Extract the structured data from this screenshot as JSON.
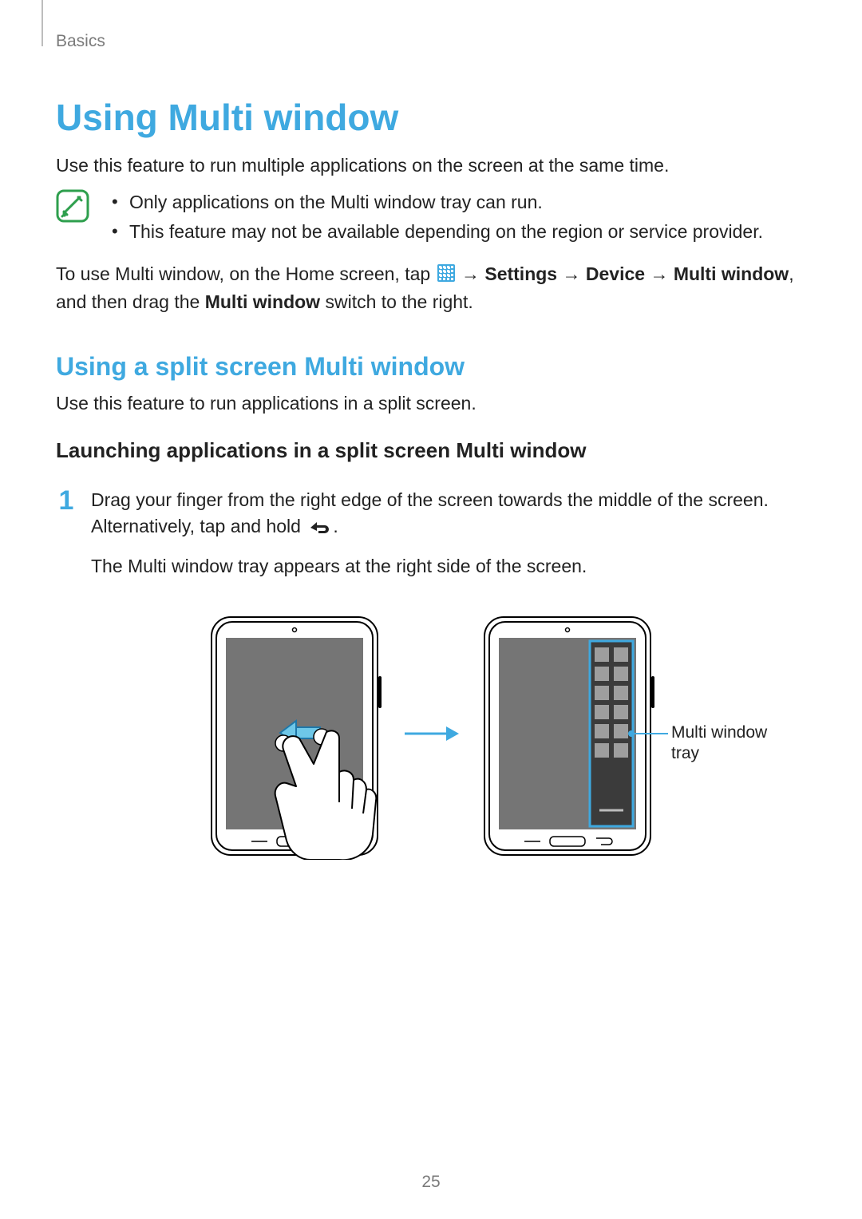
{
  "breadcrumb": "Basics",
  "title": "Using Multi window",
  "intro": "Use this feature to run multiple applications on the screen at the same time.",
  "notes": [
    "Only applications on the Multi window tray can run.",
    "This feature may not be available depending on the region or service provider."
  ],
  "instruction": {
    "pre": "To use Multi window, on the Home screen, tap ",
    "arrow": " → ",
    "settings": "Settings",
    "device": "Device",
    "multi_window": "Multi window",
    "tail1": ", and then drag the ",
    "bold_switch": "Multi window",
    "tail2": " switch to the right."
  },
  "subtitle": "Using a split screen Multi window",
  "sub_intro": "Use this feature to run applications in a split screen.",
  "subsub": "Launching applications in a split screen Multi window",
  "step1": {
    "num": "1",
    "line1a": "Drag your finger from the right edge of the screen towards the middle of the screen. Alternatively, tap and hold ",
    "line1b": ".",
    "line2": "The Multi window tray appears at the right side of the screen."
  },
  "callout": "Multi window\ntray",
  "page_number": "25",
  "icons": {
    "note_icon": "note-icon",
    "apps_icon": "apps-grid-icon",
    "back_icon": "back-icon"
  },
  "colors": {
    "accent": "#3fa9e0",
    "accent_fill": "#6ec7e8"
  }
}
